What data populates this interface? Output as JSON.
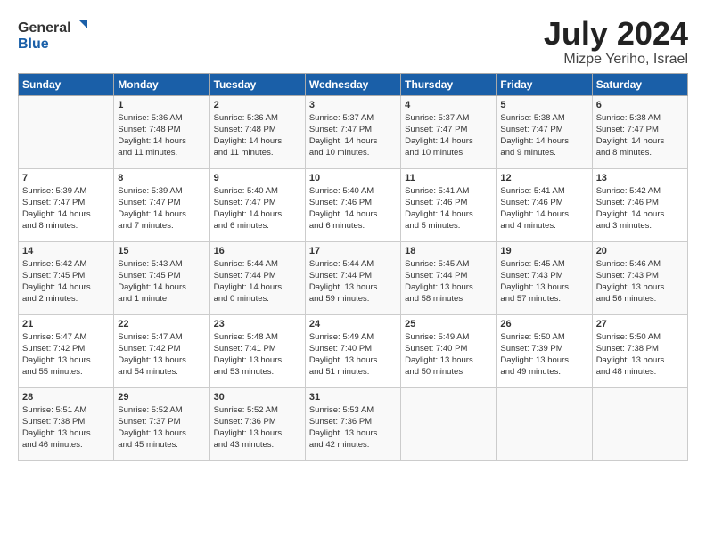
{
  "header": {
    "logo_general": "General",
    "logo_blue": "Blue",
    "month_year": "July 2024",
    "location": "Mizpe Yeriho, Israel"
  },
  "days_of_week": [
    "Sunday",
    "Monday",
    "Tuesday",
    "Wednesday",
    "Thursday",
    "Friday",
    "Saturday"
  ],
  "weeks": [
    [
      {
        "day": "",
        "info": ""
      },
      {
        "day": "1",
        "info": "Sunrise: 5:36 AM\nSunset: 7:48 PM\nDaylight: 14 hours\nand 11 minutes."
      },
      {
        "day": "2",
        "info": "Sunrise: 5:36 AM\nSunset: 7:48 PM\nDaylight: 14 hours\nand 11 minutes."
      },
      {
        "day": "3",
        "info": "Sunrise: 5:37 AM\nSunset: 7:47 PM\nDaylight: 14 hours\nand 10 minutes."
      },
      {
        "day": "4",
        "info": "Sunrise: 5:37 AM\nSunset: 7:47 PM\nDaylight: 14 hours\nand 10 minutes."
      },
      {
        "day": "5",
        "info": "Sunrise: 5:38 AM\nSunset: 7:47 PM\nDaylight: 14 hours\nand 9 minutes."
      },
      {
        "day": "6",
        "info": "Sunrise: 5:38 AM\nSunset: 7:47 PM\nDaylight: 14 hours\nand 8 minutes."
      }
    ],
    [
      {
        "day": "7",
        "info": "Sunrise: 5:39 AM\nSunset: 7:47 PM\nDaylight: 14 hours\nand 8 minutes."
      },
      {
        "day": "8",
        "info": "Sunrise: 5:39 AM\nSunset: 7:47 PM\nDaylight: 14 hours\nand 7 minutes."
      },
      {
        "day": "9",
        "info": "Sunrise: 5:40 AM\nSunset: 7:47 PM\nDaylight: 14 hours\nand 6 minutes."
      },
      {
        "day": "10",
        "info": "Sunrise: 5:40 AM\nSunset: 7:46 PM\nDaylight: 14 hours\nand 6 minutes."
      },
      {
        "day": "11",
        "info": "Sunrise: 5:41 AM\nSunset: 7:46 PM\nDaylight: 14 hours\nand 5 minutes."
      },
      {
        "day": "12",
        "info": "Sunrise: 5:41 AM\nSunset: 7:46 PM\nDaylight: 14 hours\nand 4 minutes."
      },
      {
        "day": "13",
        "info": "Sunrise: 5:42 AM\nSunset: 7:46 PM\nDaylight: 14 hours\nand 3 minutes."
      }
    ],
    [
      {
        "day": "14",
        "info": "Sunrise: 5:42 AM\nSunset: 7:45 PM\nDaylight: 14 hours\nand 2 minutes."
      },
      {
        "day": "15",
        "info": "Sunrise: 5:43 AM\nSunset: 7:45 PM\nDaylight: 14 hours\nand 1 minute."
      },
      {
        "day": "16",
        "info": "Sunrise: 5:44 AM\nSunset: 7:44 PM\nDaylight: 14 hours\nand 0 minutes."
      },
      {
        "day": "17",
        "info": "Sunrise: 5:44 AM\nSunset: 7:44 PM\nDaylight: 13 hours\nand 59 minutes."
      },
      {
        "day": "18",
        "info": "Sunrise: 5:45 AM\nSunset: 7:44 PM\nDaylight: 13 hours\nand 58 minutes."
      },
      {
        "day": "19",
        "info": "Sunrise: 5:45 AM\nSunset: 7:43 PM\nDaylight: 13 hours\nand 57 minutes."
      },
      {
        "day": "20",
        "info": "Sunrise: 5:46 AM\nSunset: 7:43 PM\nDaylight: 13 hours\nand 56 minutes."
      }
    ],
    [
      {
        "day": "21",
        "info": "Sunrise: 5:47 AM\nSunset: 7:42 PM\nDaylight: 13 hours\nand 55 minutes."
      },
      {
        "day": "22",
        "info": "Sunrise: 5:47 AM\nSunset: 7:42 PM\nDaylight: 13 hours\nand 54 minutes."
      },
      {
        "day": "23",
        "info": "Sunrise: 5:48 AM\nSunset: 7:41 PM\nDaylight: 13 hours\nand 53 minutes."
      },
      {
        "day": "24",
        "info": "Sunrise: 5:49 AM\nSunset: 7:40 PM\nDaylight: 13 hours\nand 51 minutes."
      },
      {
        "day": "25",
        "info": "Sunrise: 5:49 AM\nSunset: 7:40 PM\nDaylight: 13 hours\nand 50 minutes."
      },
      {
        "day": "26",
        "info": "Sunrise: 5:50 AM\nSunset: 7:39 PM\nDaylight: 13 hours\nand 49 minutes."
      },
      {
        "day": "27",
        "info": "Sunrise: 5:50 AM\nSunset: 7:38 PM\nDaylight: 13 hours\nand 48 minutes."
      }
    ],
    [
      {
        "day": "28",
        "info": "Sunrise: 5:51 AM\nSunset: 7:38 PM\nDaylight: 13 hours\nand 46 minutes."
      },
      {
        "day": "29",
        "info": "Sunrise: 5:52 AM\nSunset: 7:37 PM\nDaylight: 13 hours\nand 45 minutes."
      },
      {
        "day": "30",
        "info": "Sunrise: 5:52 AM\nSunset: 7:36 PM\nDaylight: 13 hours\nand 43 minutes."
      },
      {
        "day": "31",
        "info": "Sunrise: 5:53 AM\nSunset: 7:36 PM\nDaylight: 13 hours\nand 42 minutes."
      },
      {
        "day": "",
        "info": ""
      },
      {
        "day": "",
        "info": ""
      },
      {
        "day": "",
        "info": ""
      }
    ]
  ]
}
